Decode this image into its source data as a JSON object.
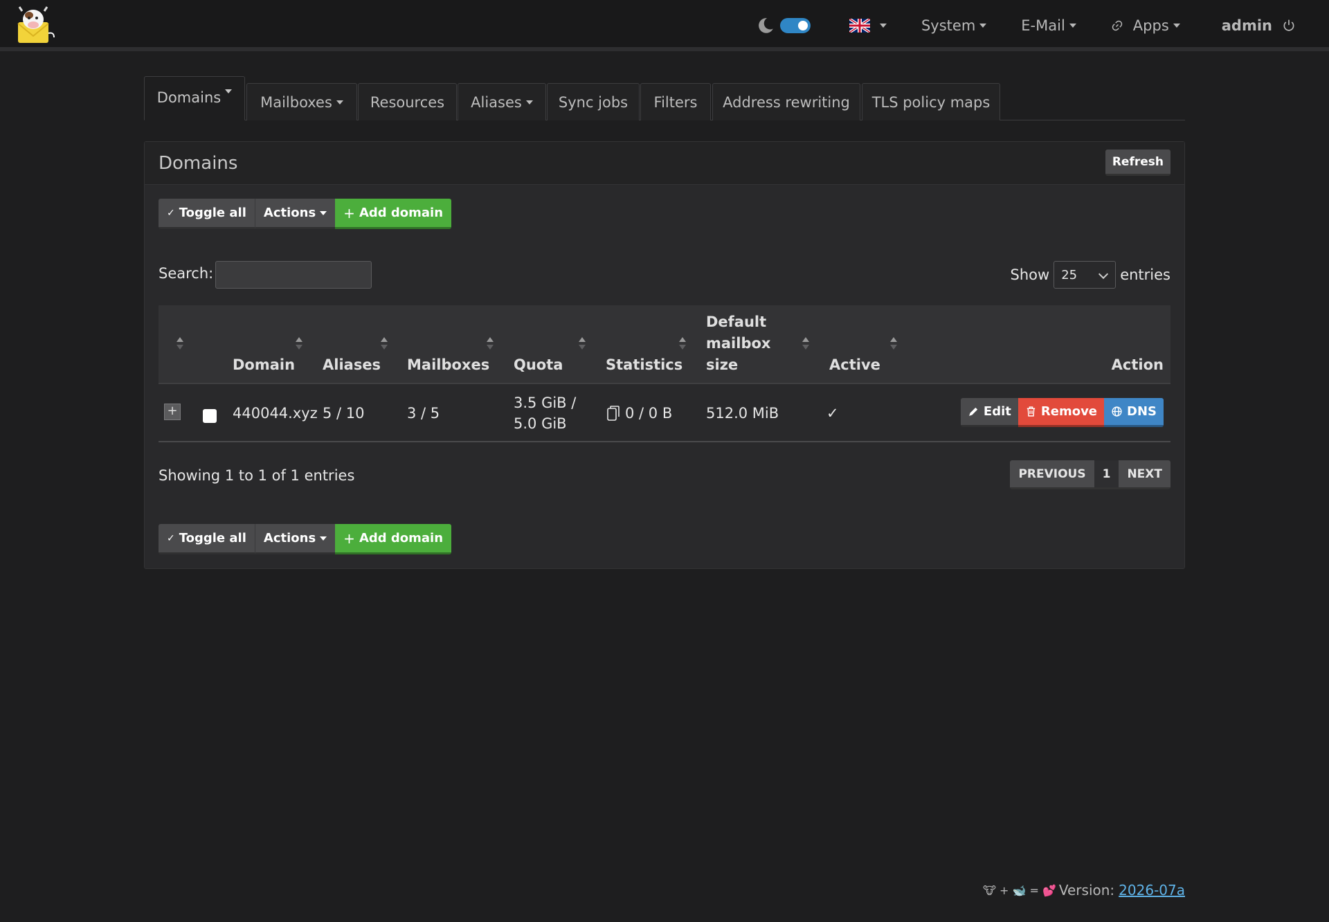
{
  "navbar": {
    "theme_toggle_on": true,
    "language_flag": "uk-flag",
    "system_label": "System",
    "email_label": "E-Mail",
    "apps_label": "Apps",
    "user_label": "admin"
  },
  "tabs": [
    {
      "label": "Domains",
      "dropdown": true,
      "active": true
    },
    {
      "label": "Mailboxes",
      "dropdown": true
    },
    {
      "label": "Resources"
    },
    {
      "label": "Aliases",
      "dropdown": true
    },
    {
      "label": "Sync jobs"
    },
    {
      "label": "Filters"
    },
    {
      "label": "Address rewriting"
    },
    {
      "label": "TLS policy maps"
    }
  ],
  "panel": {
    "title": "Domains",
    "refresh_label": "Refresh",
    "toolbar": {
      "toggle_all_label": "Toggle all",
      "actions_label": "Actions",
      "add_domain_label": "Add domain"
    },
    "search_label": "Search:",
    "search_value": "",
    "show_label": "Show",
    "entries_label": "entries",
    "page_size": "25"
  },
  "table": {
    "headers": {
      "domain": "Domain",
      "aliases": "Aliases",
      "mailboxes": "Mailboxes",
      "quota": "Quota",
      "statistics": "Statistics",
      "default_mailbox_size_1": "Default",
      "default_mailbox_size_2": "mailbox",
      "default_mailbox_size_3": "size",
      "active": "Active",
      "action": "Action"
    },
    "rows": [
      {
        "expand": "+",
        "domain": "440044.xyz",
        "aliases": "5 / 10",
        "mailboxes": "3 / 5",
        "quota_line1": "3.5 GiB /",
        "quota_line2": "5.0 GiB",
        "statistics": "0 / 0 B",
        "default_mailbox_size": "512.0 MiB",
        "active": "✓",
        "edit_label": "Edit",
        "remove_label": "Remove",
        "dns_label": "DNS"
      }
    ]
  },
  "pagination": {
    "summary": "Showing 1 to 1 of 1 entries",
    "previous_label": "PREVIOUS",
    "current_page": "1",
    "next_label": "NEXT"
  },
  "footer": {
    "emoji_text": "🐮 + 🐋 = 💕",
    "version_label": "Version:",
    "version": "2026-07a"
  },
  "colors": {
    "background": "#1e1e1f",
    "green": "#4cae3c",
    "red": "#e24a3b",
    "blue": "#3f86c6",
    "toggle": "#2f86c5"
  }
}
